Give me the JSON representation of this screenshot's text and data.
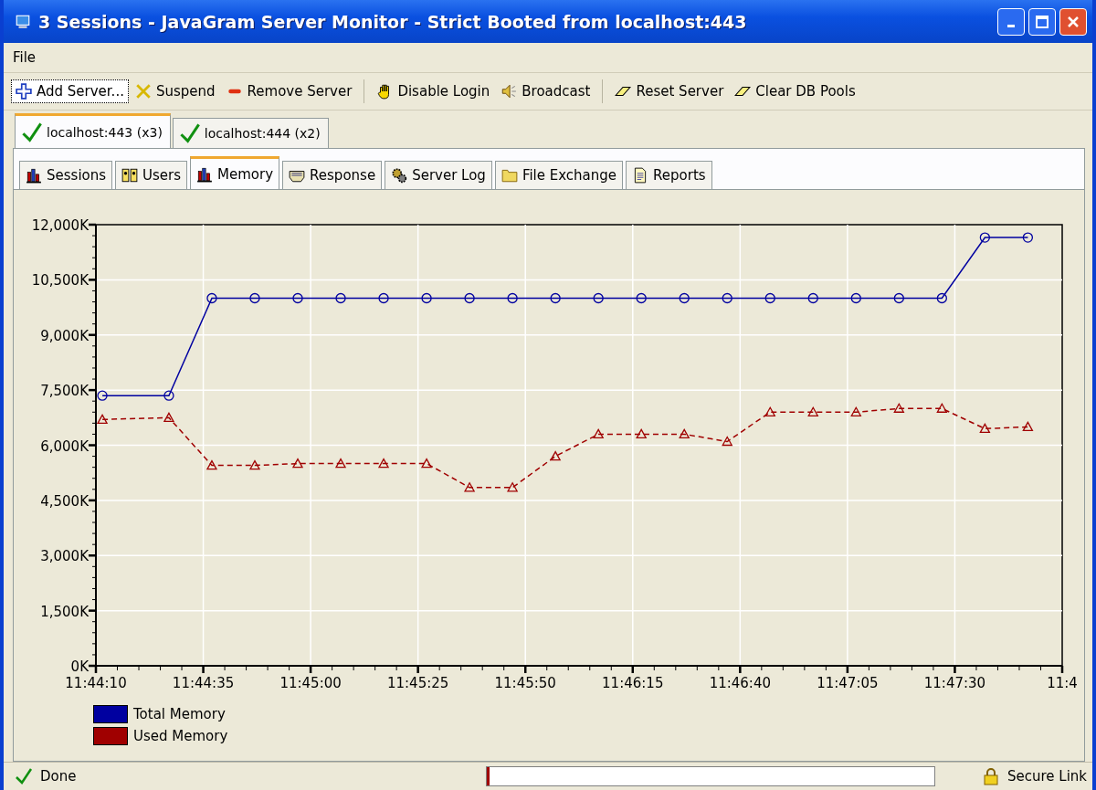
{
  "window": {
    "title": "3 Sessions - JavaGram Server Monitor - Strict Booted from localhost:443"
  },
  "menu": [
    "File"
  ],
  "toolbar": [
    [
      {
        "label": "Add Server..."
      },
      {
        "label": "Suspend"
      },
      {
        "label": "Remove Server"
      }
    ],
    [
      {
        "label": "Disable Login"
      },
      {
        "label": "Broadcast"
      }
    ],
    [
      {
        "label": "Reset Server"
      },
      {
        "label": "Clear DB Pools"
      }
    ]
  ],
  "server_tabs": [
    {
      "label": "localhost:443 (x3)",
      "selected": true
    },
    {
      "label": "localhost:444 (x2)",
      "selected": false
    }
  ],
  "view_tabs": [
    {
      "label": "Sessions",
      "selected": false
    },
    {
      "label": "Users",
      "selected": false
    },
    {
      "label": "Memory",
      "selected": true
    },
    {
      "label": "Response",
      "selected": false
    },
    {
      "label": "Server Log",
      "selected": false
    },
    {
      "label": "File Exchange",
      "selected": false
    },
    {
      "label": "Reports",
      "selected": false
    }
  ],
  "chart_data": {
    "type": "line",
    "x": [
      42251.5,
      42267,
      42277,
      42287,
      42297,
      42307,
      42317,
      42327,
      42337,
      42347,
      42357,
      42367,
      42377,
      42387,
      42397,
      42407,
      42417,
      42427,
      42437,
      42447,
      42457,
      42467
    ],
    "series": [
      {
        "name": "Total Memory",
        "color": "#0000a0",
        "line_style": "solid",
        "marker": "circle",
        "values": [
          7350,
          7350,
          10000,
          10000,
          10000,
          10000,
          10000,
          10000,
          10000,
          10000,
          10000,
          10000,
          10000,
          10000,
          10000,
          10000,
          10000,
          10000,
          10000,
          10000,
          11650,
          11650
        ]
      },
      {
        "name": "Used Memory",
        "color": "#a00000",
        "line_style": "dashed",
        "marker": "triangle",
        "values": [
          6700,
          6750,
          5450,
          5450,
          5500,
          5500,
          5500,
          5500,
          4850,
          4850,
          5700,
          6300,
          6300,
          6300,
          6100,
          6900,
          6900,
          6900,
          7000,
          7000,
          6450,
          6500
        ]
      }
    ],
    "xlim": [
      42250,
      42475
    ],
    "ylim": [
      0,
      12000
    ],
    "grid": true,
    "legend": true,
    "xticks": [
      {
        "value": 42250,
        "label": "11:44:10"
      },
      {
        "value": 42275,
        "label": "11:44:35"
      },
      {
        "value": 42300,
        "label": "11:45:00"
      },
      {
        "value": 42325,
        "label": "11:45:25"
      },
      {
        "value": 42350,
        "label": "11:45:50"
      },
      {
        "value": 42375,
        "label": "11:46:15"
      },
      {
        "value": 42400,
        "label": "11:46:40"
      },
      {
        "value": 42425,
        "label": "11:47:05"
      },
      {
        "value": 42450,
        "label": "11:47:30"
      },
      {
        "value": 42475,
        "label": "11:4"
      }
    ],
    "yticks": [
      {
        "value": 0,
        "label": "0K"
      },
      {
        "value": 1500,
        "label": "1,500K"
      },
      {
        "value": 3000,
        "label": "3,000K"
      },
      {
        "value": 4500,
        "label": "4,500K"
      },
      {
        "value": 6000,
        "label": "6,000K"
      },
      {
        "value": 7500,
        "label": "7,500K"
      },
      {
        "value": 9000,
        "label": "9,000K"
      },
      {
        "value": 10500,
        "label": "10,500K"
      },
      {
        "value": 12000,
        "label": "12,000K"
      }
    ]
  },
  "status_bar": {
    "message": "Done",
    "progress": {
      "level": 0
    },
    "security": "Secure Link"
  }
}
